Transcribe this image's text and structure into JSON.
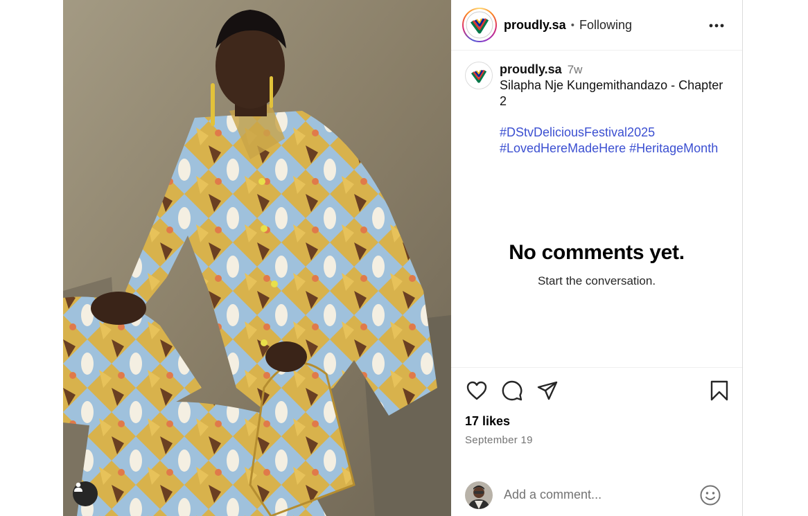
{
  "post": {
    "author": "proudly.sa",
    "separator": "•",
    "follow_status": "Following",
    "posted_ago": "7w",
    "caption_line": "Silapha Nje Kungemithandazo - Chapter 2",
    "hashtags": [
      "#DStvDeliciousFestival2025",
      "#LovedHereMadeHere",
      "#HeritageMonth"
    ],
    "likes": "17 likes",
    "date": "September 19"
  },
  "comments": {
    "empty_title": "No comments yet.",
    "empty_subtitle": "Start the conversation."
  },
  "comment_box": {
    "placeholder": "Add a comment..."
  },
  "icons": {
    "more": "more-options-icon",
    "like": "heart-icon",
    "comment": "comment-bubble-icon",
    "share": "paper-plane-icon",
    "save": "bookmark-icon",
    "emoji": "smiley-icon",
    "tags": "person-tag-icon"
  },
  "colors": {
    "hashtag": "#3b4fd1",
    "muted": "#737373"
  }
}
